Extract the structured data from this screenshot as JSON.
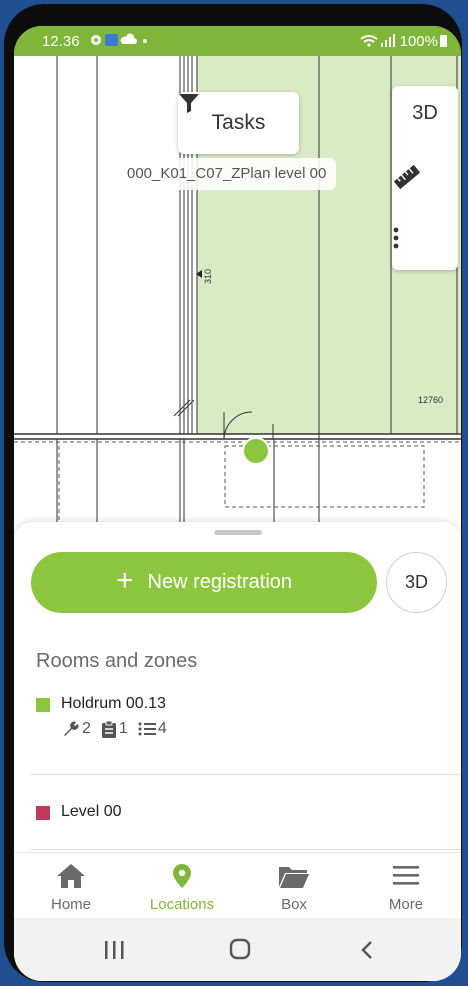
{
  "status_bar": {
    "time": "12.36",
    "notification_icons": [
      "gear-icon",
      "app-icon",
      "cloud-icon",
      "dot-icon"
    ],
    "battery": "100%"
  },
  "map": {
    "tasks_label": "Tasks",
    "plan_name": "000_K01_C07_ZPlan level 00",
    "dim_vertical": "310",
    "dim_horizontal": "12760",
    "tools": {
      "view_3d": "3D"
    }
  },
  "sheet": {
    "new_registration": "New registration",
    "view_3d": "3D",
    "section_title": "Rooms and zones",
    "rooms": [
      {
        "name": "Holdrum 00.13",
        "color": "#8cc63f",
        "counts": {
          "wrench": "2",
          "clipboard": "1",
          "list": "4"
        }
      },
      {
        "name": "Level 00",
        "color": "#c0395e"
      }
    ]
  },
  "bottom_nav": {
    "items": [
      {
        "label": "Home",
        "icon": "home-icon"
      },
      {
        "label": "Locations",
        "icon": "location-pin-icon",
        "active": true
      },
      {
        "label": "Box",
        "icon": "folder-icon"
      },
      {
        "label": "More",
        "icon": "menu-icon"
      }
    ]
  },
  "colors": {
    "accent": "#8cc63f",
    "status_bar": "#7fb63a",
    "zone_fill": "#d9ebc5"
  }
}
